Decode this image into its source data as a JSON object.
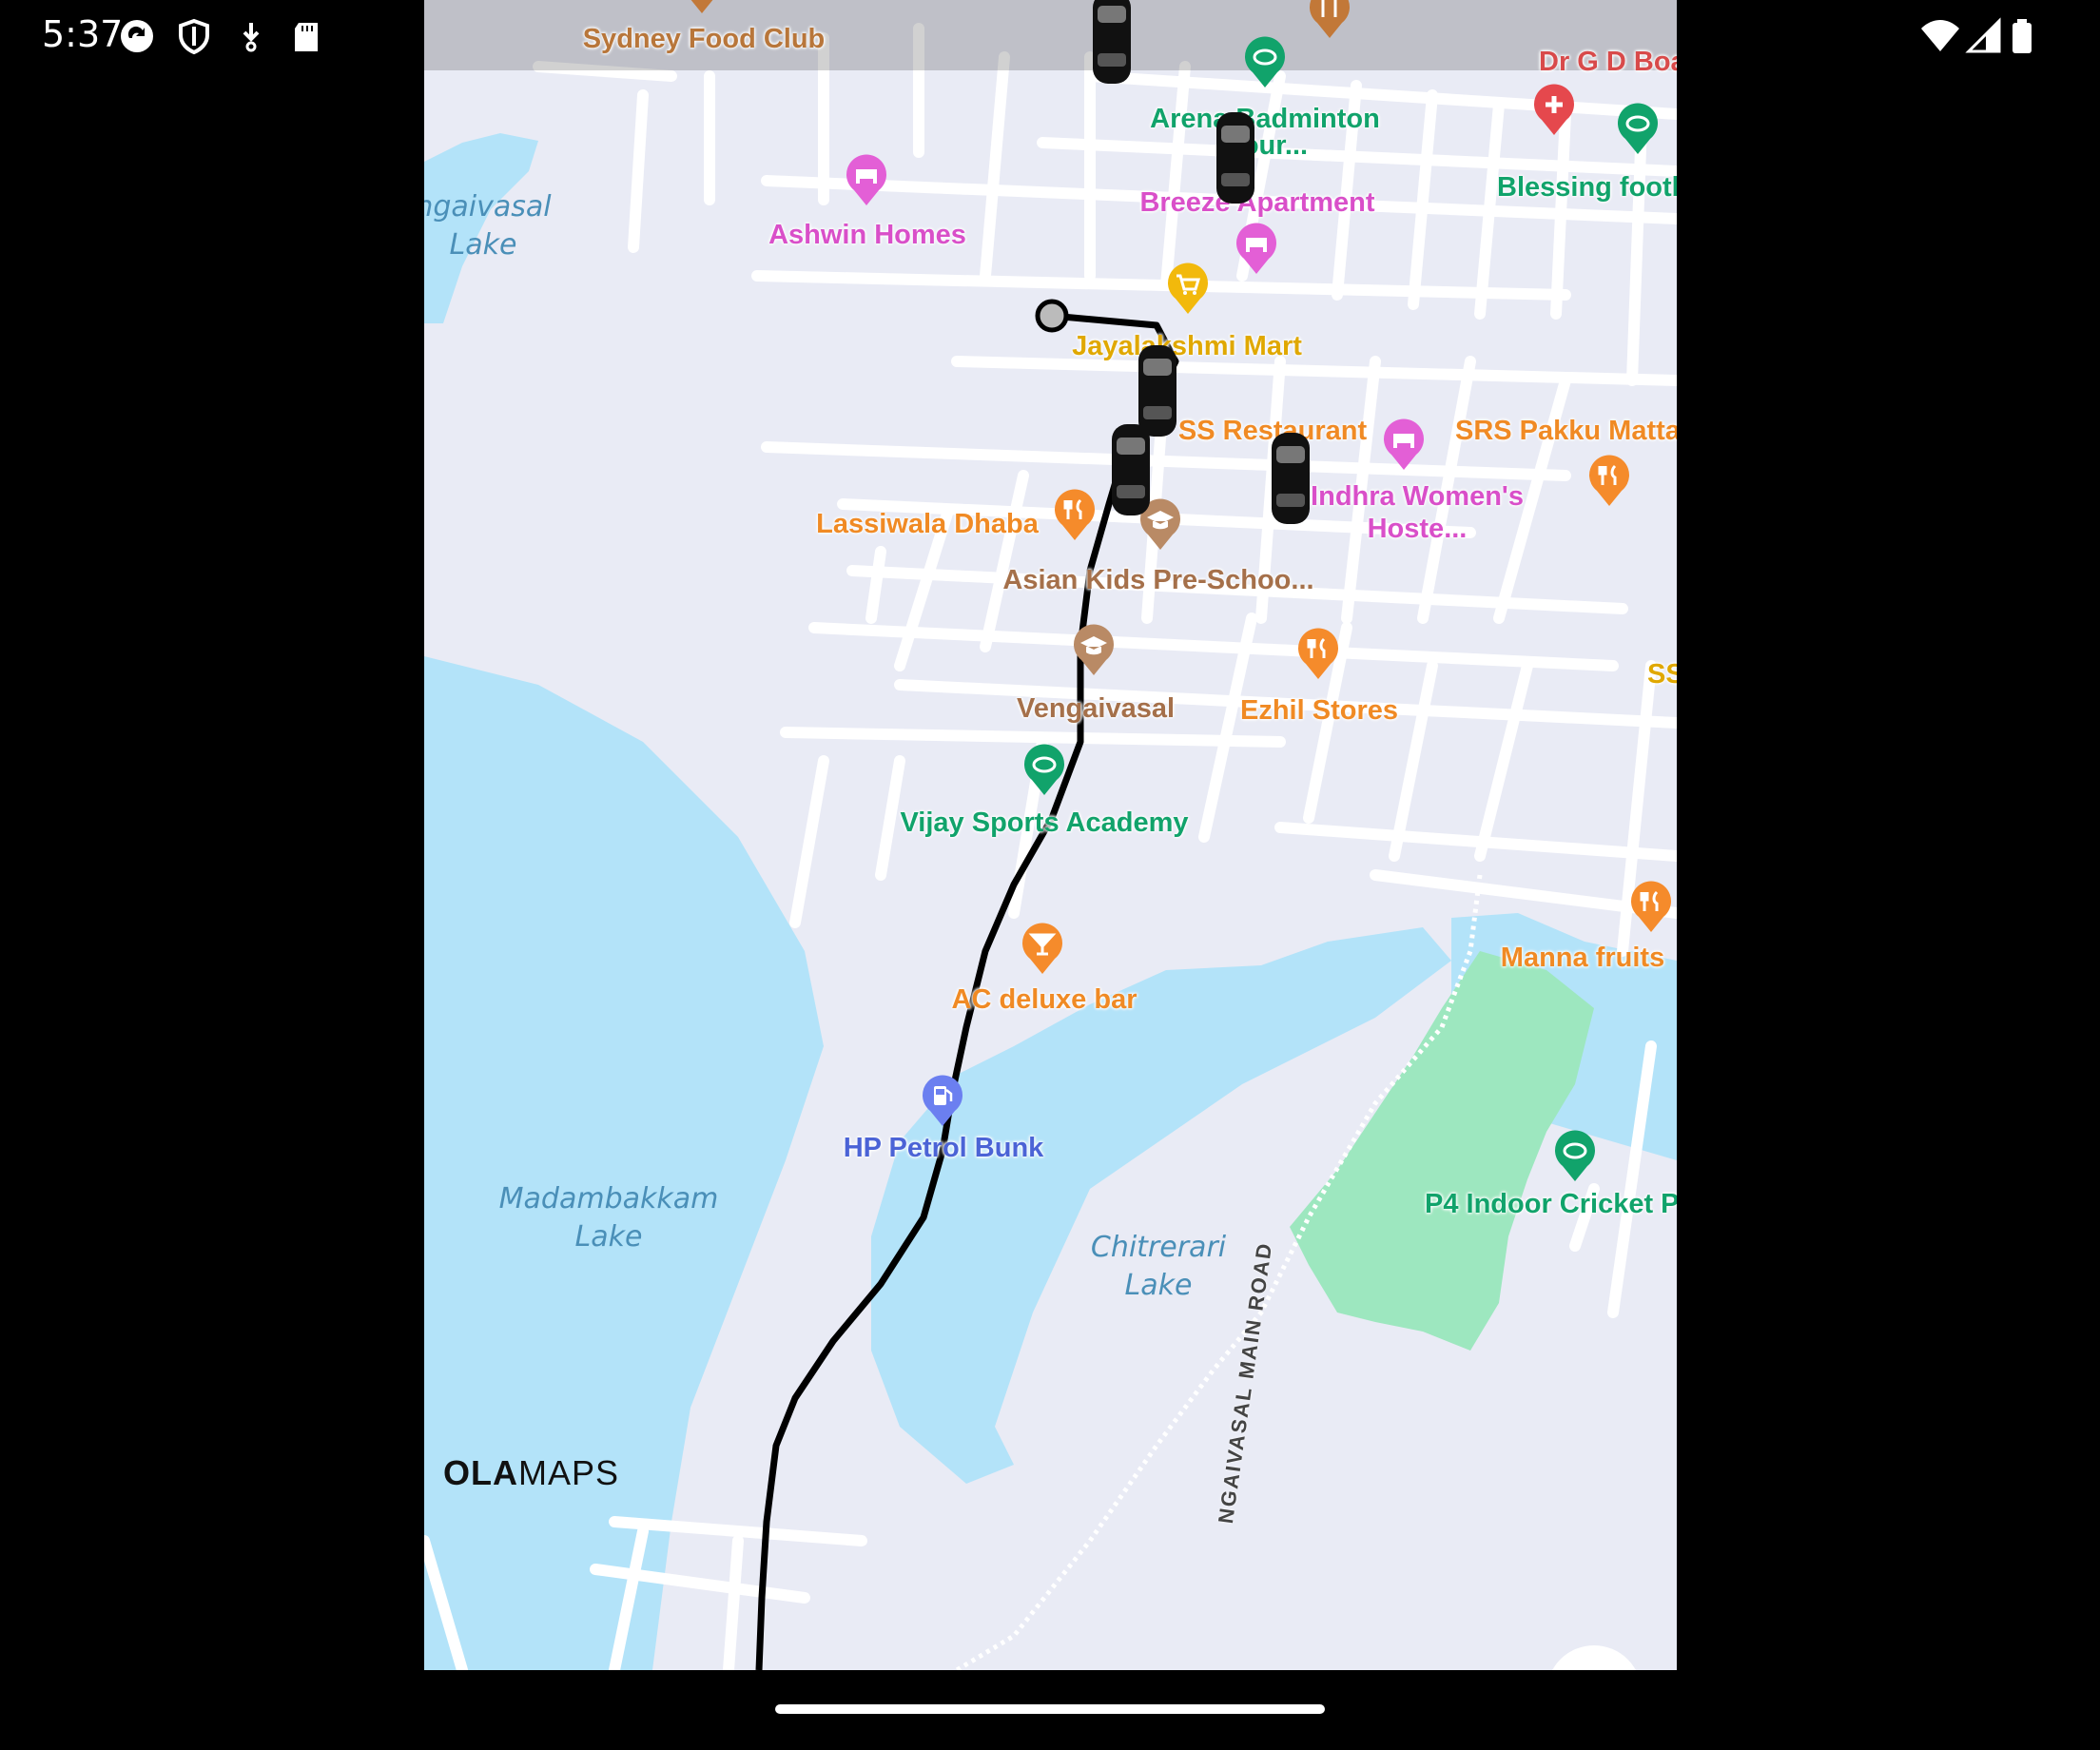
{
  "status_bar": {
    "time": "5:37",
    "left_icons": [
      "sync-icon",
      "shield-icon",
      "download-icon",
      "sd-card-icon"
    ],
    "right_icons": [
      "wifi-icon",
      "signal-icon",
      "battery-icon"
    ]
  },
  "map": {
    "brand": {
      "bold": "OLA",
      "light": "MAPS"
    },
    "road_label": "NGAIVASAL MAIN ROAD",
    "water_labels": [
      {
        "id": "vengaivasal-lake",
        "line1": "ngaivasal",
        "line2": "Lake"
      },
      {
        "id": "madambakkam-lake",
        "line1": "Madambakkam",
        "line2": "Lake"
      },
      {
        "id": "chitrerari-lake",
        "line1": "Chitrerari",
        "line2": "Lake"
      }
    ],
    "pois": [
      {
        "label": "Sydney Food Club",
        "color": "#b8763a"
      },
      {
        "label": "Dr G D Boaz Memoria",
        "color": "#d84a4a"
      },
      {
        "label": "Arena Badminton",
        "label2": "Cour...",
        "color": "#11a36b"
      },
      {
        "label": "Blessing footb",
        "color": "#11a36b"
      },
      {
        "label": "Ashwin Homes",
        "color": "#d94fc9"
      },
      {
        "label": "Breeze Apartment",
        "color": "#d94fc9"
      },
      {
        "label": "Jayalakshmi Mart",
        "color": "#e0a800"
      },
      {
        "label": "SS Restaurant",
        "color": "#f08a24"
      },
      {
        "label": "SRS Pakku Matta",
        "color": "#f08a24"
      },
      {
        "label": "Indhra Women's",
        "label2": "Hoste...",
        "color": "#d94fc9"
      },
      {
        "label": "Lassiwala Dhaba",
        "color": "#f08a24"
      },
      {
        "label": "Asian Kids Pre-Schoo...",
        "color": "#a5704a"
      },
      {
        "label": "Vengaivasal",
        "color": "#a5704a"
      },
      {
        "label": "Ezhil Stores",
        "color": "#f08a24"
      },
      {
        "label": "SS",
        "color": "#e0a800"
      },
      {
        "label": "Vijay Sports Academy",
        "color": "#11a36b"
      },
      {
        "label": "Manna fruits",
        "color": "#f08a24"
      },
      {
        "label": "AC deluxe bar",
        "color": "#f08a24"
      },
      {
        "label": "HP Petrol Bunk",
        "color": "#4b63d6"
      },
      {
        "label": "P4 Indoor Cricket P",
        "color": "#11a36b"
      }
    ]
  }
}
